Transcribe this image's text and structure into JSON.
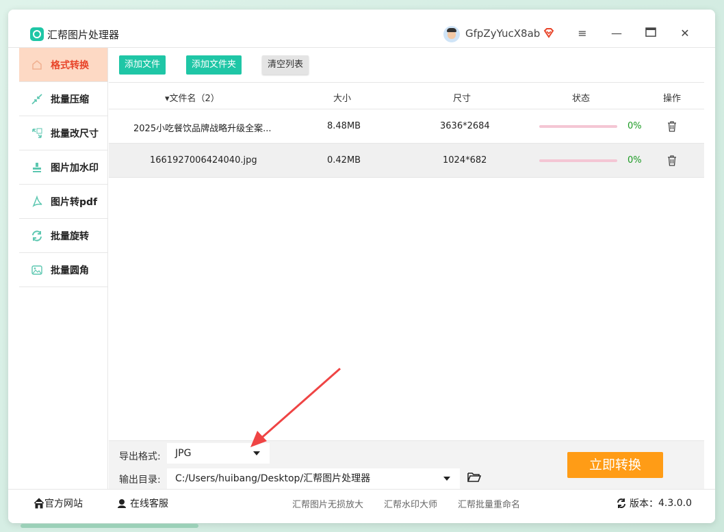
{
  "window": {
    "title": "汇帮图片处理器",
    "username": "GfpZyYucX8ab",
    "accent_color": "#1fc6a6",
    "active_color": "#e8452a"
  },
  "sidebar": {
    "items": [
      {
        "label": "格式转换",
        "icon": "format-convert-icon",
        "active": true
      },
      {
        "label": "批量压缩",
        "icon": "compress-icon"
      },
      {
        "label": "批量改尺寸",
        "icon": "resize-icon"
      },
      {
        "label": "图片加水印",
        "icon": "watermark-icon"
      },
      {
        "label": "图片转pdf",
        "icon": "pdf-icon"
      },
      {
        "label": "批量旋转",
        "icon": "rotate-icon"
      },
      {
        "label": "批量圆角",
        "icon": "round-corner-icon"
      }
    ]
  },
  "toolbar": {
    "add_file": "添加文件",
    "add_folder": "添加文件夹",
    "clear_list": "清空列表"
  },
  "table": {
    "headers": {
      "name": "文件名（2）",
      "size": "大小",
      "dimensions": "尺寸",
      "status": "状态",
      "action": "操作"
    },
    "rows": [
      {
        "name": "2025小吃餐饮品牌战略升级全案...",
        "size": "8.48MB",
        "dimensions": "3636*2684",
        "progress": "0%"
      },
      {
        "name": "1661927006424040.jpg",
        "size": "0.42MB",
        "dimensions": "1024*682",
        "progress": "0%"
      }
    ]
  },
  "options": {
    "format_label": "导出格式:",
    "format_value": "JPG",
    "output_label": "输出目录:",
    "output_value": "C:/Users/huibang/Desktop/汇帮图片处理器"
  },
  "convert_button": "立即转换",
  "footer": {
    "website": "官方网站",
    "service": "在线客服",
    "link1": "汇帮图片无损放大",
    "link2": "汇帮水印大师",
    "link3": "汇帮批量重命名",
    "version_label": "版本：",
    "version": "4.3.0.0"
  }
}
